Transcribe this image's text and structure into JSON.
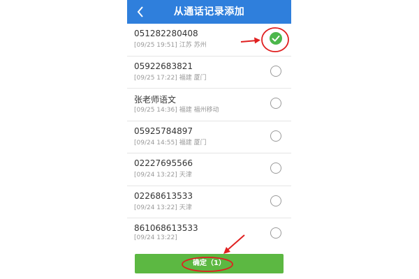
{
  "header": {
    "title": "从通话记录添加",
    "back_icon": "chevron-left-icon",
    "background": "#2f7fdc"
  },
  "calls": [
    {
      "number": "051282280408",
      "time": "[09/25 19:51]",
      "location": "江苏 苏州",
      "checked": true
    },
    {
      "number": "05922683821",
      "time": "[09/25 17:22]",
      "location": "福建 厦门",
      "checked": false
    },
    {
      "number": "张老师语文",
      "time": "[09/25 14:36]",
      "location": "福建 福州移动",
      "checked": false
    },
    {
      "number": "05925784897",
      "time": "[09/24 14:55]",
      "location": "福建 厦门",
      "checked": false
    },
    {
      "number": "02227695566",
      "time": "[09/24 13:22]",
      "location": "天津",
      "checked": false
    },
    {
      "number": "02268613533",
      "time": "[09/24 13:22]",
      "location": "天津",
      "checked": false
    },
    {
      "number": "861068613533",
      "time": "[09/24 13:22]",
      "location": "",
      "checked": false
    }
  ],
  "confirm_button": {
    "label": "确定（1）",
    "background": "#5cb842"
  },
  "annotation_color": "#e02020"
}
